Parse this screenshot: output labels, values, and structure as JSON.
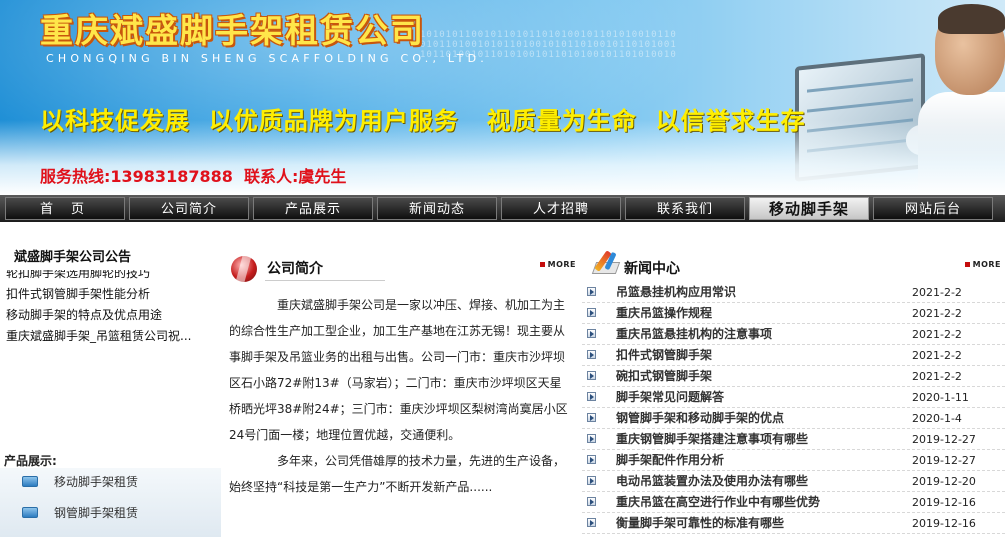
{
  "banner": {
    "company_name": "重庆斌盛脚手架租赁公司",
    "company_en": "CHONGQING BIN SHENG SCAFFOLDING CO., LTD.",
    "slogan": "以科技促发展  以优质品牌为用户服务   视质量为生命  以信誉求生存",
    "hotline": "服务热线:13983187888  联系人:虞先生",
    "decor_digits": "1010101100101101011010100101101010010110 0101101001010110100101011010010110101001 1011010010110101001011010100101101010010"
  },
  "nav": {
    "items": [
      {
        "label": "首页"
      },
      {
        "label": "公司简介"
      },
      {
        "label": "产品展示"
      },
      {
        "label": "新闻动态"
      },
      {
        "label": "人才招聘"
      },
      {
        "label": "联系我们"
      },
      {
        "label": "移动脚手架"
      },
      {
        "label": "网站后台"
      }
    ]
  },
  "notice": {
    "title": "斌盛脚手架公司公告",
    "items": [
      "轮扣脚手架选用脚轮的技巧",
      "扣件式钢管脚手架性能分析",
      "移动脚手架的特点及优点用途",
      "重庆斌盛脚手架_吊篮租赁公司祝..."
    ]
  },
  "products": {
    "title": "产品展示:",
    "items": [
      "移动脚手架租赁",
      "钢管脚手架租赁"
    ]
  },
  "company_intro": {
    "title": "公司简介",
    "more": "MORE",
    "paragraph1": "重庆斌盛脚手架公司是一家以冲压、焊接、机加工为主的综合性生产加工型企业，加工生产基地在江苏无锡！现主要从事脚手架及吊篮业务的出租与出售。公司一门市：重庆市沙坪坝区石小路72#附13#（马家岩）；二门市：重庆市沙坪坝区天星桥晒光坪38#附24#；三门市：重庆沙坪坝区梨树湾尚寞居小区24号门面一楼；地理位置优越，交通便利。",
    "paragraph2": "多年来，公司凭借雄厚的技术力量，先进的生产设备，始终坚持“科技是第一生产力”不断开发新产品......"
  },
  "news": {
    "title": "新闻中心",
    "more": "MORE",
    "items": [
      {
        "title": "吊篮悬挂机构应用常识",
        "date": "2021-2-2"
      },
      {
        "title": "重庆吊篮操作规程",
        "date": "2021-2-2"
      },
      {
        "title": "重庆吊篮悬挂机构的注意事项",
        "date": "2021-2-2"
      },
      {
        "title": "扣件式钢管脚手架",
        "date": "2021-2-2"
      },
      {
        "title": "碗扣式钢管脚手架",
        "date": "2021-2-2"
      },
      {
        "title": "脚手架常见问题解答",
        "date": "2020-1-11"
      },
      {
        "title": "钢管脚手架和移动脚手架的优点",
        "date": "2020-1-4"
      },
      {
        "title": "重庆钢管脚手架搭建注意事项有哪些",
        "date": "2019-12-27"
      },
      {
        "title": "脚手架配件作用分析",
        "date": "2019-12-27"
      },
      {
        "title": "电动吊篮装置办法及使用办法有哪些",
        "date": "2019-12-20"
      },
      {
        "title": "重庆吊篮在高空进行作业中有哪些优势",
        "date": "2019-12-16"
      },
      {
        "title": "衡量脚手架可靠性的标准有哪些",
        "date": "2019-12-16"
      }
    ]
  }
}
